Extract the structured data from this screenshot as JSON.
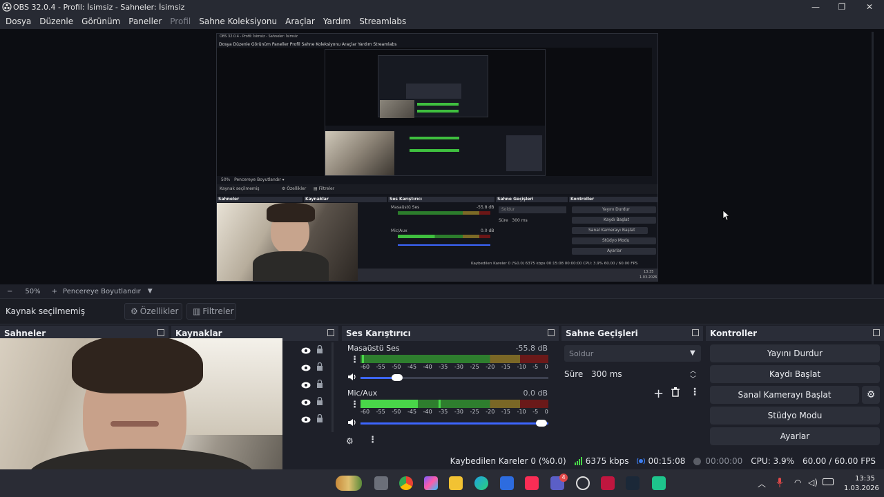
{
  "window": {
    "title": "OBS 32.0.4 - Profil: İsimsiz - Sahneler: İsimsiz",
    "controls": [
      "minimize-icon",
      "maximize-icon",
      "close-icon"
    ]
  },
  "menu": {
    "items": [
      "Dosya",
      "Düzenle",
      "Görünüm",
      "Paneller",
      "Profil",
      "Sahne Koleksiyonu",
      "Araçlar",
      "Yardım",
      "Streamlabs"
    ]
  },
  "nested_preview": {
    "title": "OBS 32.0.4 - Profil: İsimsiz - Sahneler: İsimsiz",
    "menu": "Dosya   Düzenle   Görünüm   Paneller   Profil   Sahne Koleksiyonu   Araçlar   Yardım   Streamlabs",
    "zoom": "50%",
    "zoom_mode": "Pencereye Boyutlandır",
    "source": "Kaynak seçilmemiş",
    "properties": "Özellikler",
    "filters": "Filtreler",
    "docks": [
      "Sahneler",
      "Kaynaklar",
      "Ses Karıştırıcı",
      "Sahne Geçişleri",
      "Kontroller"
    ],
    "mixer": [
      {
        "name": "Masaüstü Ses",
        "db": "-55.8 dB"
      },
      {
        "name": "Mic/Aux",
        "db": "0.0 dB"
      }
    ],
    "transition": "Soldur",
    "duration_label": "Süre",
    "duration_value": "300 ms",
    "controls": [
      "Yayını Durdur",
      "Kaydı Başlat",
      "Sanal Kamerayı Başlat",
      "Stüdyo Modu",
      "Ayarlar"
    ],
    "status": "Kaybedilen Kareler 0 (%0.0)   6375 kbps   00:15:08   00:00:00   CPU: 3.9%   60.00 / 60.00 FPS",
    "time": "13:35",
    "date": "1.03.2026"
  },
  "zoombar": {
    "minus": "−",
    "zoom": "50%",
    "plus": "+",
    "mode": "Pencereye Boyutlandır"
  },
  "sourcebar": {
    "label": "Kaynak seçilmemiş",
    "properties": "Özellikler",
    "filters": "Filtreler"
  },
  "docks": {
    "scenes": {
      "title": "Sahneler"
    },
    "sources": {
      "title": "Kaynaklar",
      "rows": 5
    },
    "mixer": {
      "title": "Ses Karıştırıcı",
      "channels": [
        {
          "name": "Masaüstü Ses",
          "db": "-55.8 dB",
          "level": 0.0,
          "volume": 0.2
        },
        {
          "name": "Mic/Aux",
          "db": "0.0 dB",
          "level": 0.3,
          "volume": 0.95
        }
      ],
      "scale": [
        "-60",
        "-55",
        "-50",
        "-45",
        "-40",
        "-35",
        "-30",
        "-25",
        "-20",
        "-15",
        "-10",
        "-5",
        "0"
      ]
    },
    "transitions": {
      "title": "Sahne Geçişleri",
      "selected": "Soldur",
      "duration_label": "Süre",
      "duration_value": "300 ms"
    },
    "controls": {
      "title": "Kontroller",
      "stop_stream": "Yayını Durdur",
      "start_record": "Kaydı Başlat",
      "start_virtualcam": "Sanal Kamerayı Başlat",
      "studio_mode": "Stüdyo Modu",
      "settings": "Ayarlar"
    }
  },
  "status": {
    "dropped": "Kaybedilen Kareler 0 (%0.0)",
    "bitrate": "6375 kbps",
    "stream_time": "00:15:08",
    "record_time": "00:00:00",
    "cpu": "CPU: 3.9%",
    "fps": "60.00 / 60.00 FPS"
  },
  "taskbar": {
    "time": "13:35",
    "date": "1.03.2026",
    "badge": "4"
  },
  "colors": {
    "meter_green": "#3fbf3f",
    "meter_yellow": "#b9a13a",
    "meter_red": "#8b1c1c",
    "accent_blue": "#3d66ff",
    "live_blue": "#3c7df0"
  }
}
